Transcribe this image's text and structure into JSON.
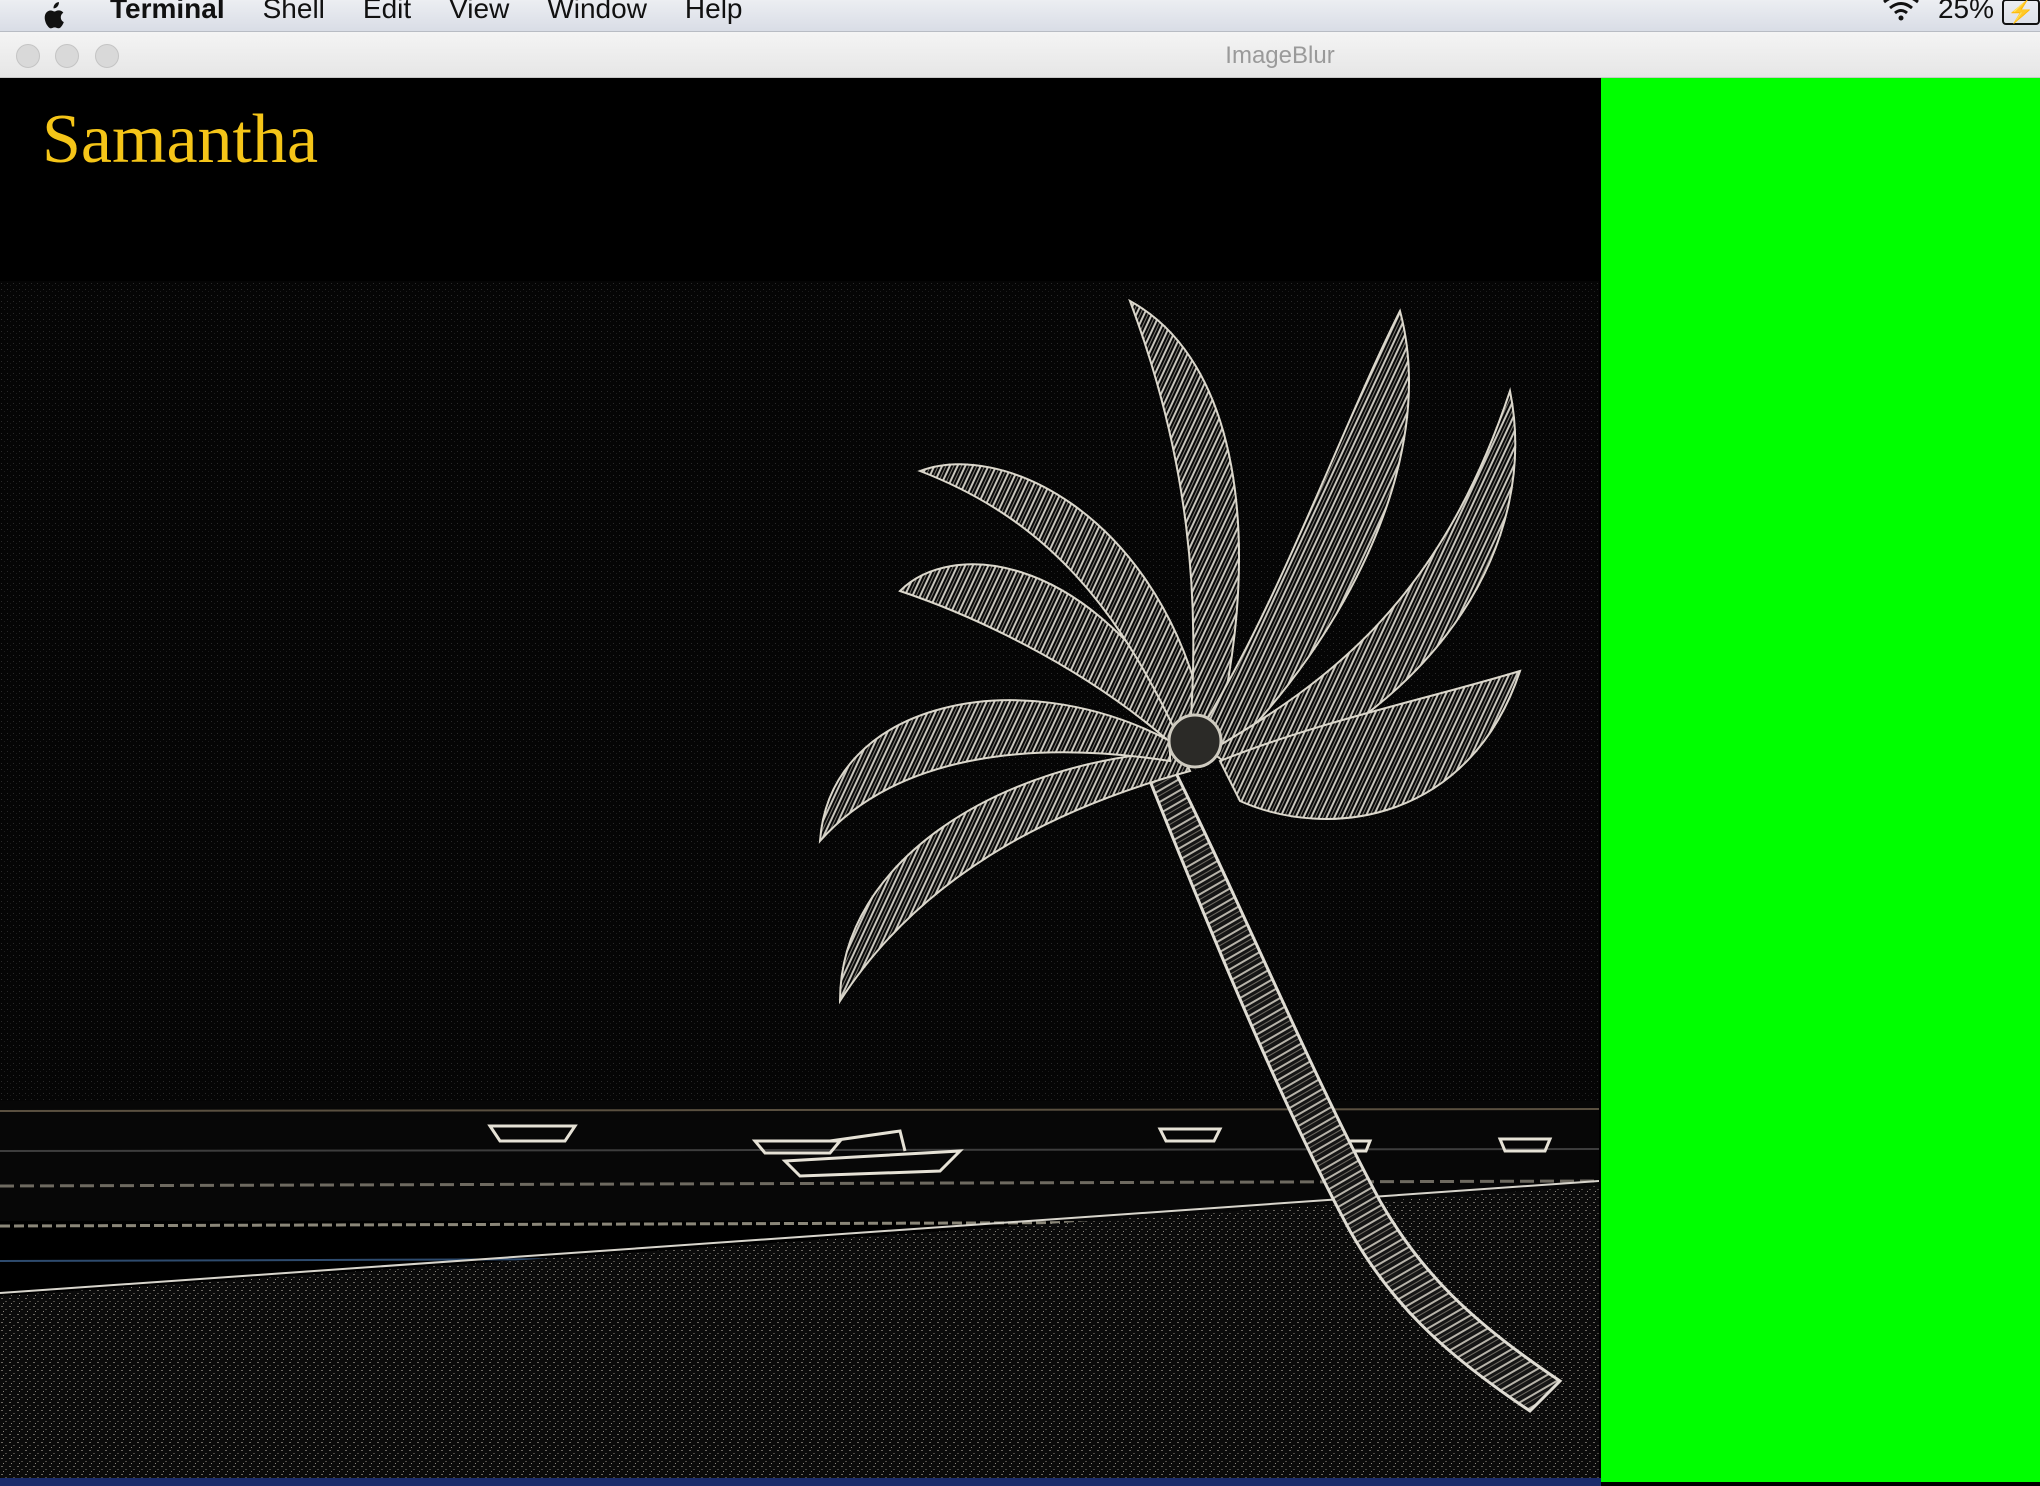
{
  "menubar": {
    "app_name": "Terminal",
    "items": [
      "Shell",
      "Edit",
      "View",
      "Window",
      "Help"
    ],
    "battery_percent": "25%"
  },
  "window": {
    "title": "ImageBlur"
  },
  "canvas": {
    "label": "Samantha",
    "label_color": "#f5c518",
    "image_description_icon": "palm-tree-beach-edge-image"
  },
  "side_panel": {
    "color": "#00ff00"
  }
}
